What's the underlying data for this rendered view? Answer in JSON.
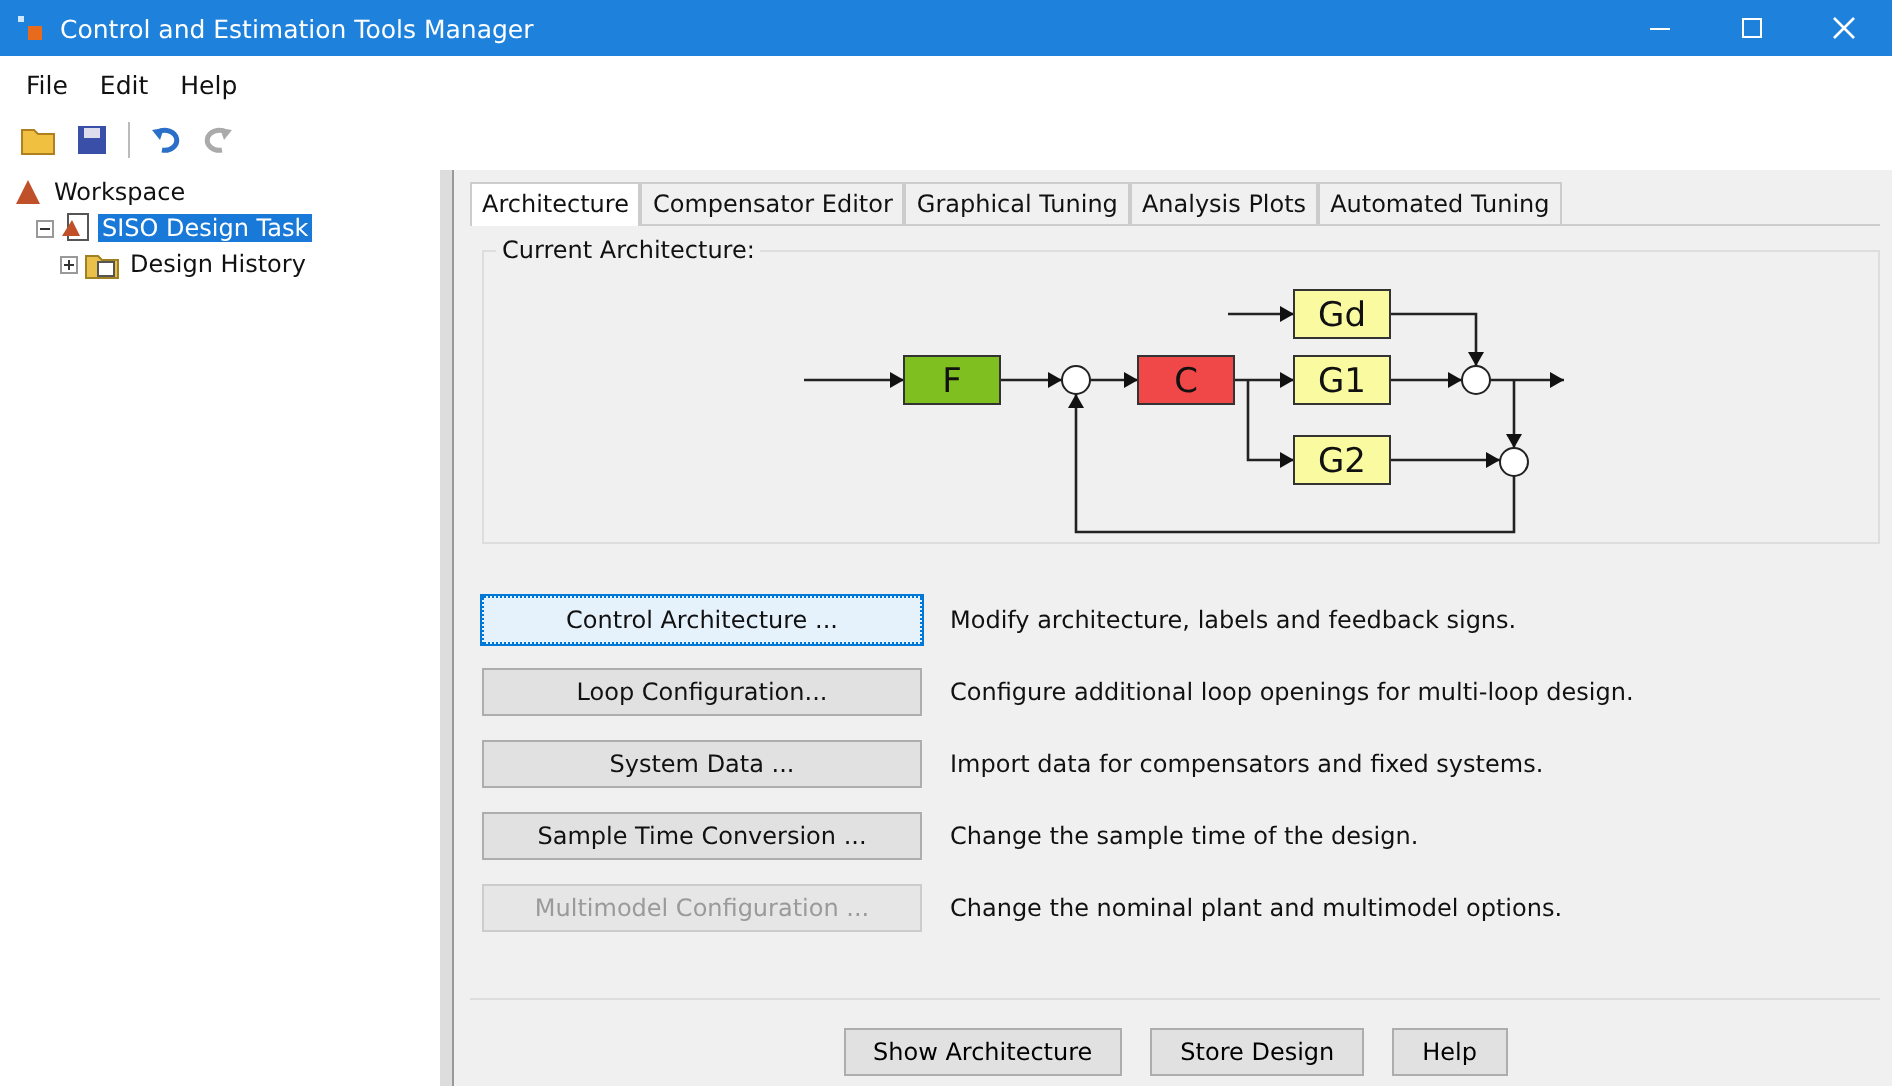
{
  "window": {
    "title": "Control and Estimation Tools Manager"
  },
  "menu": [
    "File",
    "Edit",
    "Help"
  ],
  "tree": [
    {
      "label": "Workspace",
      "selected": false,
      "children": [
        {
          "label": "SISO Design Task",
          "selected": true,
          "expanded": true,
          "children": [
            {
              "label": "Design History",
              "selected": false,
              "expanded": false
            }
          ]
        }
      ]
    }
  ],
  "tabs": [
    {
      "label": "Architecture",
      "selected": true
    },
    {
      "label": "Compensator Editor",
      "selected": false
    },
    {
      "label": "Graphical Tuning",
      "selected": false
    },
    {
      "label": "Analysis Plots",
      "selected": false
    },
    {
      "label": "Automated Tuning",
      "selected": false
    }
  ],
  "architecture": {
    "title": "Current Architecture:",
    "blocks": [
      {
        "label": "F",
        "color": "#7fbf1f"
      },
      {
        "label": "C",
        "color": "#f04848"
      },
      {
        "label": "Gd",
        "color": "#fafaa0"
      },
      {
        "label": "G1",
        "color": "#fafaa0"
      },
      {
        "label": "G2",
        "color": "#fafaa0"
      }
    ]
  },
  "actions": [
    {
      "button": "Control Architecture ...",
      "description": "Modify architecture, labels and feedback signs.",
      "disabled": false,
      "focused": true
    },
    {
      "button": "Loop Configuration...",
      "description": "Configure additional loop openings for multi-loop design.",
      "disabled": false,
      "focused": false
    },
    {
      "button": "System Data ...",
      "description": "Import data for compensators and fixed systems.",
      "disabled": false,
      "focused": false
    },
    {
      "button": "Sample Time Conversion ...",
      "description": "Change the sample time of the design.",
      "disabled": false,
      "focused": false
    },
    {
      "button": "Multimodel Configuration ...",
      "description": "Change the nominal plant and multimodel options.",
      "disabled": true,
      "focused": false
    }
  ],
  "footer_buttons": [
    "Show Architecture",
    "Store Design",
    "Help"
  ]
}
